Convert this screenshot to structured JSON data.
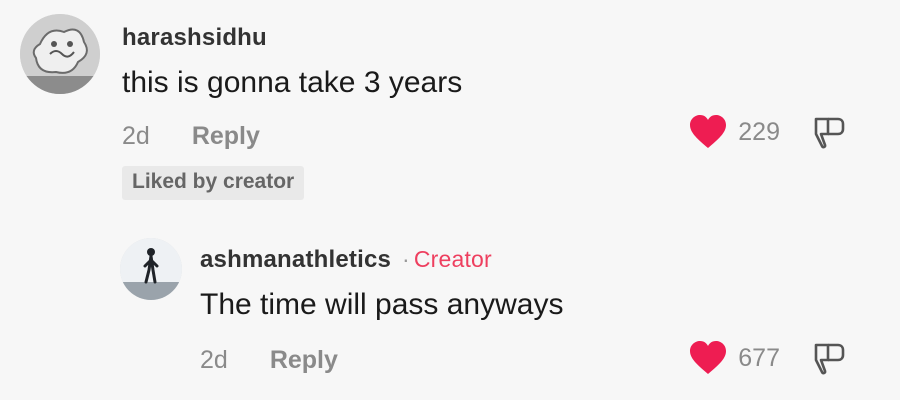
{
  "comments": [
    {
      "username": "harashsidhu",
      "text": "this is gonna take 3 years",
      "age": "2d",
      "reply_label": "Reply",
      "likes": "229",
      "badge": "Liked by creator",
      "liked": true
    },
    {
      "username": "ashmanathletics",
      "creator_dot": "·",
      "creator_label": "Creator",
      "text": "The time will pass anyways",
      "age": "2d",
      "reply_label": "Reply",
      "likes": "677",
      "liked": true
    }
  ],
  "colors": {
    "heart": "#ee1d52",
    "creator": "#ee3f5f",
    "meta": "#8a8a8a"
  },
  "icons": {
    "like": "heart-icon",
    "dislike": "thumbs-down-icon"
  }
}
